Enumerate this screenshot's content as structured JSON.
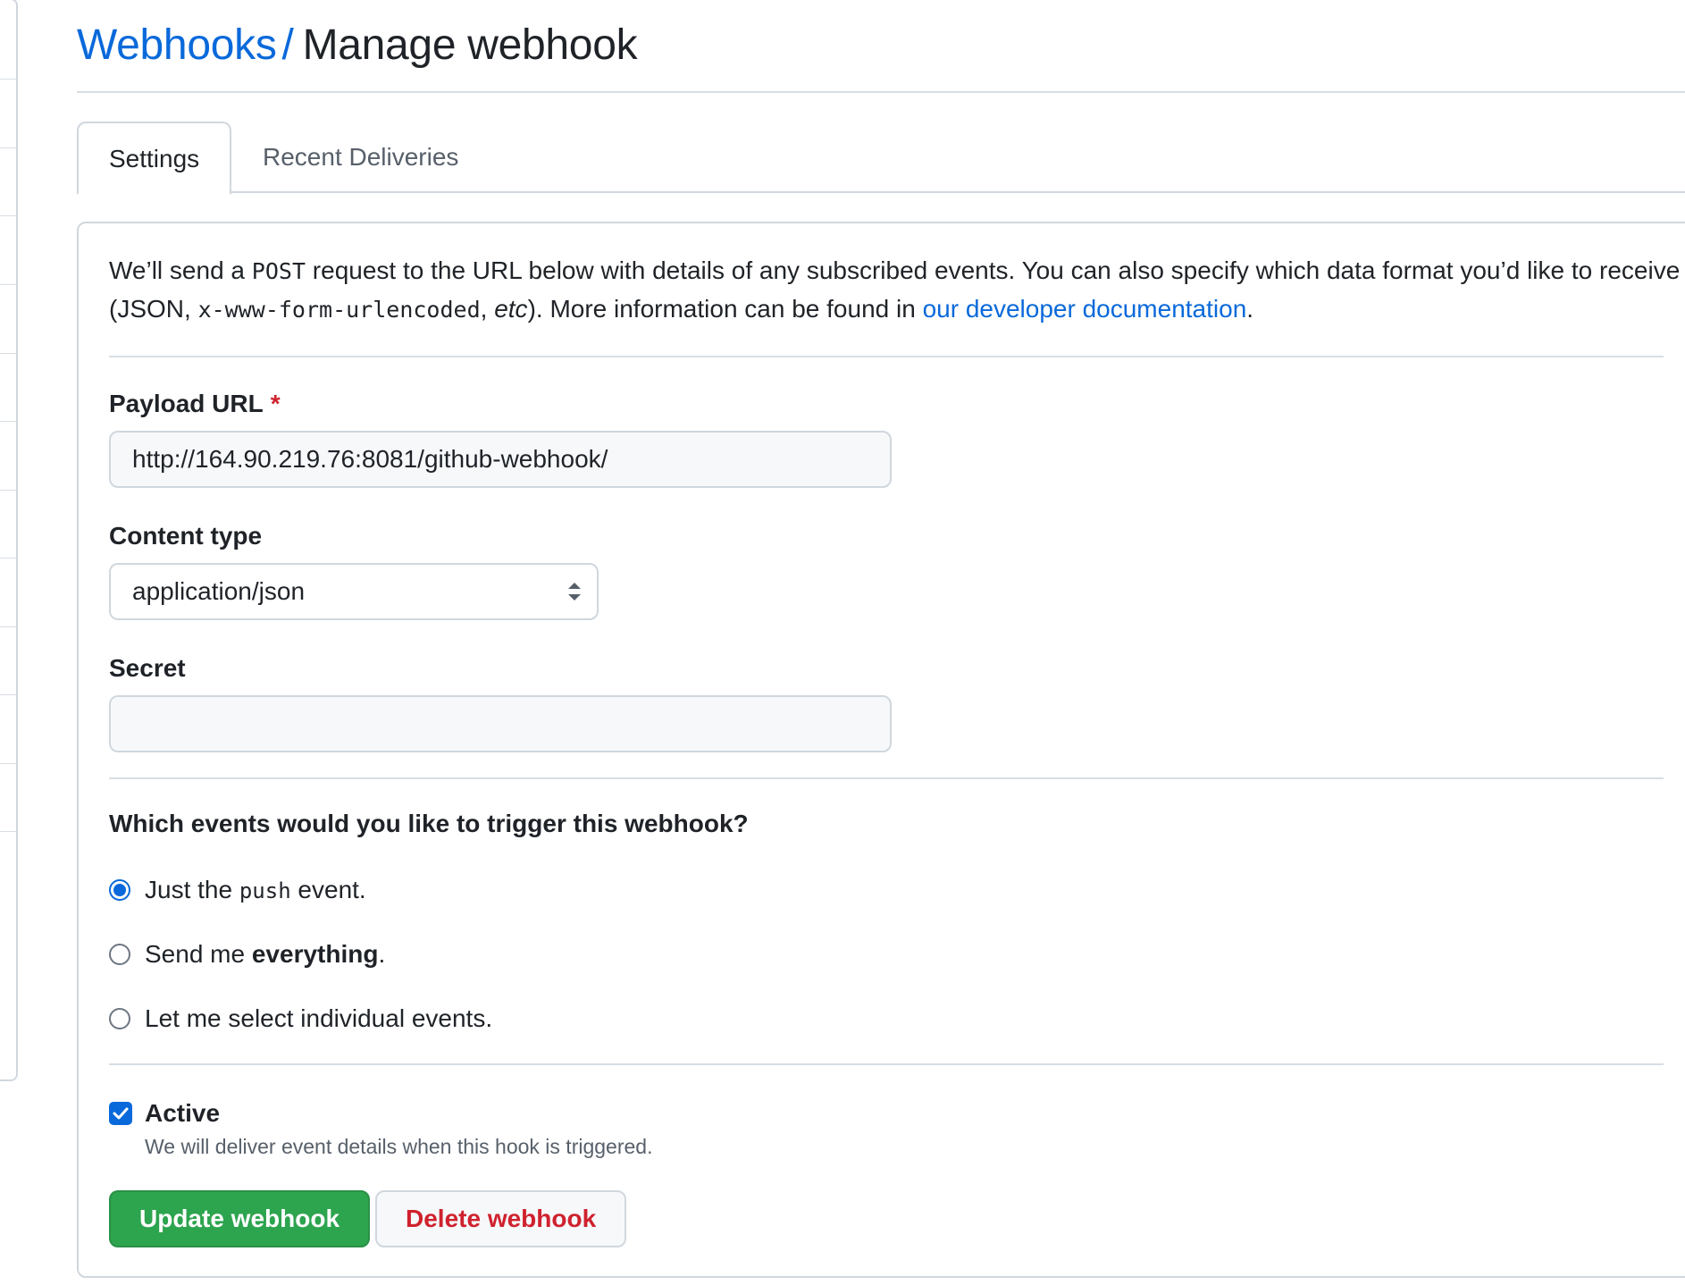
{
  "breadcrumb": {
    "parent": "Webhooks",
    "separator": "/",
    "current": "Manage webhook"
  },
  "tabs": [
    {
      "label": "Settings",
      "selected": true
    },
    {
      "label": "Recent Deliveries",
      "selected": false
    }
  ],
  "intro": {
    "part1": "We’ll send a ",
    "code1": "POST",
    "part2": " request to the URL below with details of any subscribed events. You can also specify which data format you’d like to receive (JSON, ",
    "code2": "x-www-form-urlencoded",
    "part3": ", ",
    "etc": "etc",
    "part4": "). More information can be found in ",
    "link": "our developer documentation",
    "part5": "."
  },
  "payload_url": {
    "label": "Payload URL",
    "required_mark": "*",
    "value": "http://164.90.219.76:8081/github-webhook/"
  },
  "content_type": {
    "label": "Content type",
    "selected": "application/json"
  },
  "secret": {
    "label": "Secret",
    "value": ""
  },
  "events": {
    "question": "Which events would you like to trigger this webhook?",
    "options": [
      {
        "pre": "Just the ",
        "code": "push",
        "post": " event.",
        "checked": true
      },
      {
        "pre": "Send me ",
        "bold": "everything",
        "post": ".",
        "checked": false
      },
      {
        "pre": "Let me select individual events.",
        "checked": false
      }
    ]
  },
  "active": {
    "label": "Active",
    "checked": true,
    "hint": "We will deliver event details when this hook is triggered."
  },
  "buttons": {
    "update": "Update webhook",
    "delete": "Delete webhook"
  },
  "colors": {
    "link": "#0969da",
    "primary_button": "#2da44e",
    "danger_text": "#cf222e",
    "required": "#cf222e"
  }
}
